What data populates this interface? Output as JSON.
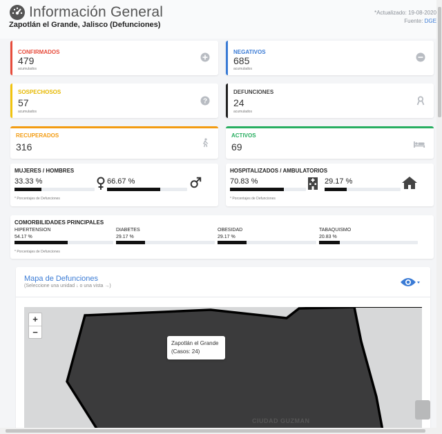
{
  "header": {
    "title": "Información General",
    "subtitle": "Zapotlán el Grande, Jalisco (Defunciones)",
    "updated": "*Actualizado: 19-08-2020",
    "source_label": "Fuente:",
    "source_link": "DGE"
  },
  "stats": {
    "confirmados": {
      "label": "CONFIRMADOS",
      "value": "479",
      "small": "acumulados",
      "color": "#e74c3c"
    },
    "negativos": {
      "label": "NEGATIVOS",
      "value": "685",
      "small": "acumulados",
      "color": "#3a7bd5"
    },
    "sospechosos": {
      "label": "SOSPECHOSOS",
      "value": "57",
      "small": "acumulados",
      "color": "#f1c40f"
    },
    "defunciones": {
      "label": "DEFUNCIONES",
      "value": "24",
      "small": "acumulados",
      "color": "#222222"
    },
    "recuperados": {
      "label": "RECUPERADOS",
      "value": "316",
      "color": "#f39c12"
    },
    "activos": {
      "label": "ACTIVOS",
      "value": "69",
      "color": "#27ae60"
    }
  },
  "gender": {
    "title": "MUJERES / HOMBRES",
    "women_pct": "33.33 %",
    "women_fraction": 0.3333,
    "men_pct": "66.67 %",
    "men_fraction": 0.6667,
    "note": "* Porcentajes  de Defunciones"
  },
  "hospital": {
    "title": "HOSPITALIZADOS / AMBULATORIOS",
    "hosp_pct": "70.83 %",
    "hosp_fraction": 0.7083,
    "amb_pct": "29.17 %",
    "amb_fraction": 0.2917,
    "note": "* Porcentajes  de Defunciones"
  },
  "comorbidities": {
    "title": "COMORBILIDADES PRINCIPALES",
    "note": "* Porcentajes  de Defunciones",
    "items": [
      {
        "label": "HIPERTENSION",
        "pct": "54.17 %",
        "fraction": 0.5417
      },
      {
        "label": "DIABETES",
        "pct": "29.17 %",
        "fraction": 0.2917
      },
      {
        "label": "OBESIDAD",
        "pct": "29.17 %",
        "fraction": 0.2917
      },
      {
        "label": "TABAQUISMO",
        "pct": "20.83 %",
        "fraction": 0.2083
      }
    ]
  },
  "map": {
    "title": "Mapa de Defunciones",
    "subtitle": "(Seleccione una unidad ↓ o una vista →)",
    "zoom_in": "+",
    "zoom_out": "−",
    "tooltip_name": "Zapotlán el Grande",
    "tooltip_cases": "(Casos: 24)",
    "city_label": "CIUDAD GUZMAN"
  }
}
